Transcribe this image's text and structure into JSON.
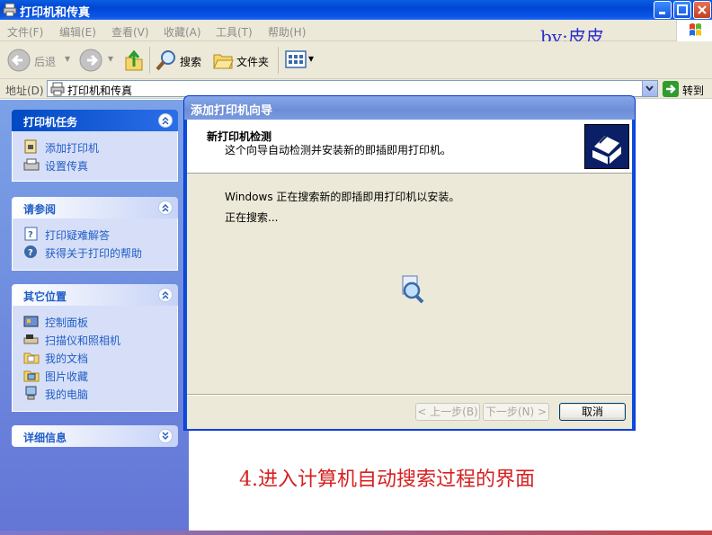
{
  "window": {
    "title": "打印机和传真",
    "buttons": {
      "minimize": "minimize",
      "maximize": "maximize",
      "close": "close"
    }
  },
  "menubar": {
    "items": [
      "文件(F)",
      "编辑(E)",
      "查看(V)",
      "收藏(A)",
      "工具(T)",
      "帮助(H)"
    ],
    "byline": "by:皮皮"
  },
  "toolbar": {
    "back_label": "后退",
    "search_label": "搜索",
    "folders_label": "文件夹"
  },
  "address": {
    "label": "地址(D)",
    "value": "打印机和传真",
    "go_label": "转到"
  },
  "left_pane": {
    "printer_tasks": {
      "title": "打印机任务",
      "items": [
        "添加打印机",
        "设置传真"
      ]
    },
    "see_also": {
      "title": "请参阅",
      "items": [
        "打印疑难解答",
        "获得关于打印的帮助"
      ]
    },
    "other_places": {
      "title": "其它位置",
      "items": [
        "控制面板",
        "扫描仪和照相机",
        "我的文档",
        "图片收藏",
        "我的电脑"
      ]
    },
    "details": {
      "title": "详细信息"
    }
  },
  "wizard": {
    "title": "添加打印机向导",
    "header_title": "新打印机检测",
    "header_subtitle": "这个向导自动检测并安装新的即插即用打印机。",
    "message_1": "Windows 正在搜索新的即插即用打印机以安装。",
    "message_2": "正在搜索...",
    "back_button": "< 上一步(B)",
    "next_button": "下一步(N) >",
    "cancel_button": "取消"
  },
  "caption": "4.进入计算机自动搜索过程的界面",
  "colors": {
    "accent_blue": "#0046d5",
    "task_link": "#215dc6",
    "caption_red": "#d62020",
    "byline_blue": "#2c2ccf"
  }
}
